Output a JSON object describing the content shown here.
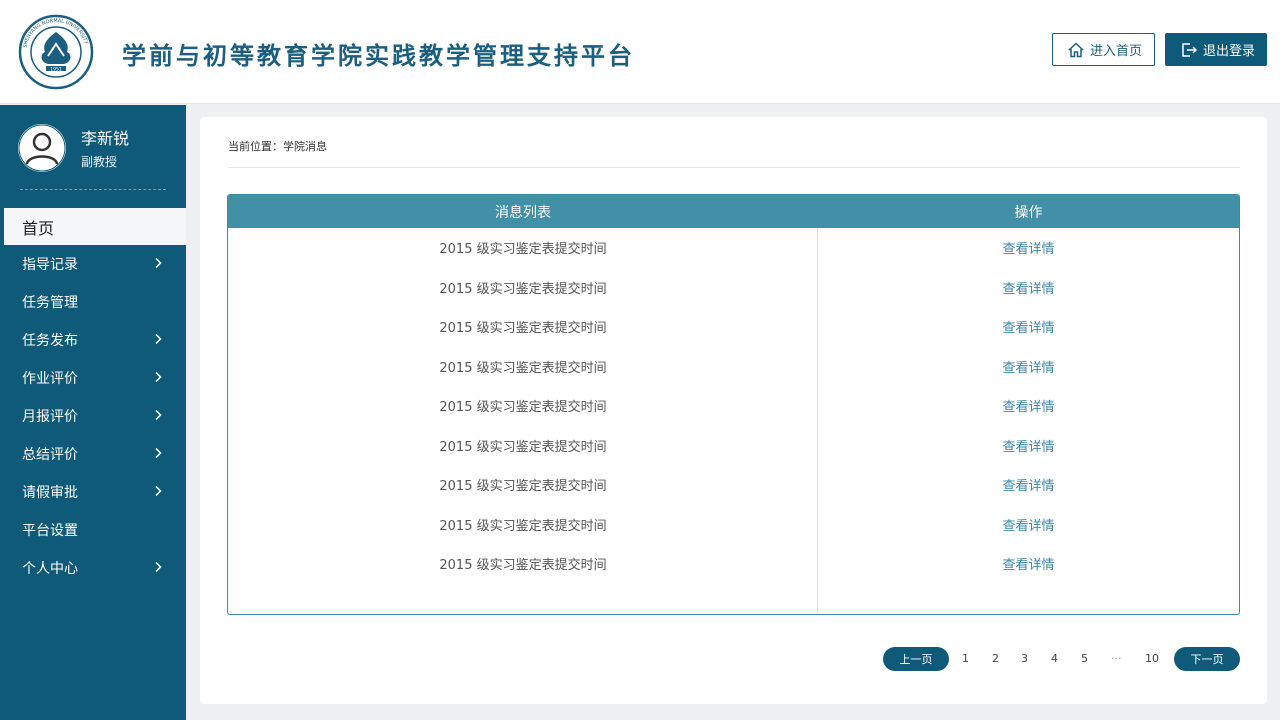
{
  "header": {
    "title": "学前与初等教育学院实践教学管理支持平台",
    "home_label": "进入首页",
    "logout_label": "退出登录",
    "logo_text": "SHENYANG NORMAL UNIVERSITY",
    "logo_year": "1951"
  },
  "user": {
    "name": "李新锐",
    "title": "副教授"
  },
  "nav": [
    {
      "label": "首页",
      "active": true,
      "chevron": false
    },
    {
      "label": "指导记录",
      "active": false,
      "chevron": true
    },
    {
      "label": "任务管理",
      "active": false,
      "chevron": false
    },
    {
      "label": "任务发布",
      "active": false,
      "chevron": true
    },
    {
      "label": "作业评价",
      "active": false,
      "chevron": true
    },
    {
      "label": "月报评价",
      "active": false,
      "chevron": true
    },
    {
      "label": "总结评价",
      "active": false,
      "chevron": true
    },
    {
      "label": "请假审批",
      "active": false,
      "chevron": true
    },
    {
      "label": "平台设置",
      "active": false,
      "chevron": false
    },
    {
      "label": "个人中心",
      "active": false,
      "chevron": true
    }
  ],
  "breadcrumb": "当前位置：学院消息",
  "table": {
    "headers": [
      "消息列表",
      "操作"
    ],
    "rows": [
      {
        "title": "2015 级实习鉴定表提交时间",
        "action": "查看详情"
      },
      {
        "title": "2015 级实习鉴定表提交时间",
        "action": "查看详情"
      },
      {
        "title": "2015 级实习鉴定表提交时间",
        "action": "查看详情"
      },
      {
        "title": "2015 级实习鉴定表提交时间",
        "action": "查看详情"
      },
      {
        "title": "2015 级实习鉴定表提交时间",
        "action": "查看详情"
      },
      {
        "title": "2015 级实习鉴定表提交时间",
        "action": "查看详情"
      },
      {
        "title": "2015 级实习鉴定表提交时间",
        "action": "查看详情"
      },
      {
        "title": "2015 级实习鉴定表提交时间",
        "action": "查看详情"
      },
      {
        "title": "2015 级实习鉴定表提交时间",
        "action": "查看详情"
      }
    ]
  },
  "pagination": {
    "prev_label": "上一页",
    "next_label": "下一页",
    "pages": [
      "1",
      "2",
      "3",
      "4",
      "5",
      "···",
      "10"
    ]
  },
  "colors": {
    "primary": "#0e5a78",
    "table_header": "#4290a8",
    "link": "#3b86a8"
  }
}
